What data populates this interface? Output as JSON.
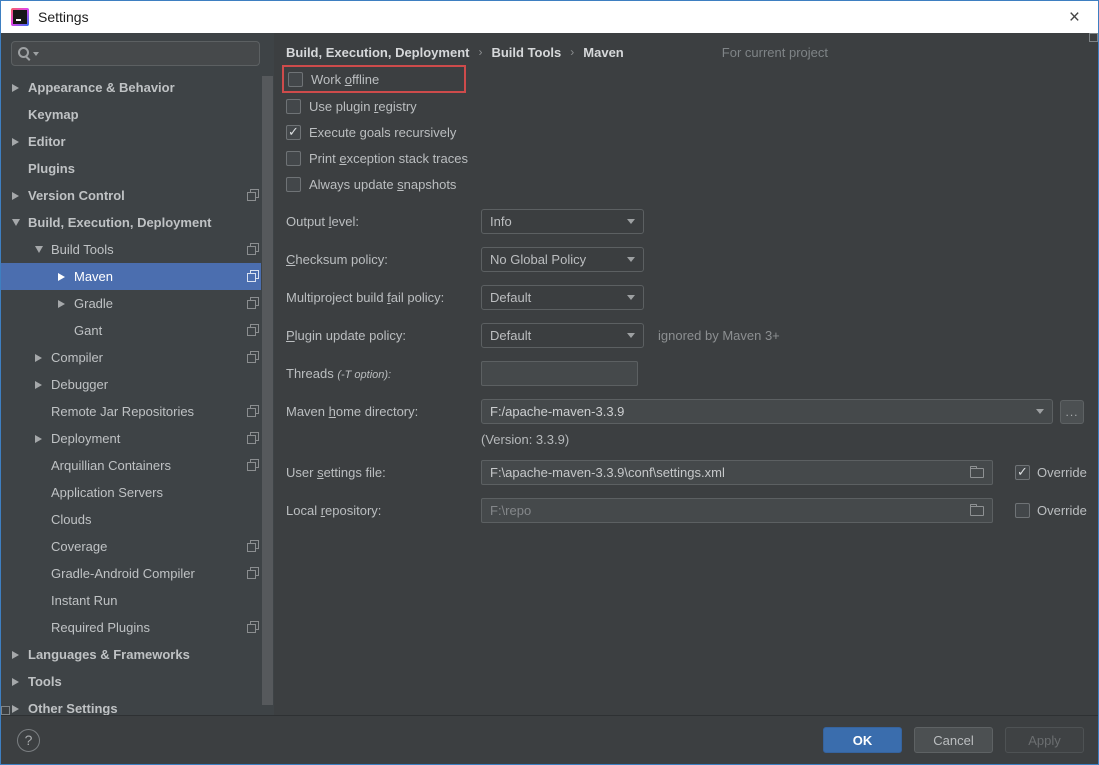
{
  "window": {
    "title": "Settings",
    "close_glyph": "×"
  },
  "colors": {
    "selection": "#4B6EAF",
    "highlight_red": "#CE4B4B",
    "ok_blue": "#3A6DAD",
    "window_border_blue": "#3E7FC1"
  },
  "icons": {
    "app_logo": "intellij-idea-logo",
    "search": "magnifier-with-caret",
    "scope_badge": "stacked-squares",
    "folder": "open-folder",
    "help": "question-mark",
    "close": "x"
  },
  "search": {
    "value": "",
    "placeholder": ""
  },
  "sidebar": {
    "items": [
      {
        "label": "Appearance & Behavior",
        "level": 0,
        "arrow": "collapsed",
        "bold": true,
        "selected": false,
        "badge": false
      },
      {
        "label": "Keymap",
        "level": 0,
        "arrow": "none",
        "bold": true,
        "selected": false,
        "badge": false
      },
      {
        "label": "Editor",
        "level": 0,
        "arrow": "collapsed",
        "bold": true,
        "selected": false,
        "badge": false
      },
      {
        "label": "Plugins",
        "level": 0,
        "arrow": "none",
        "bold": true,
        "selected": false,
        "badge": false
      },
      {
        "label": "Version Control",
        "level": 0,
        "arrow": "collapsed",
        "bold": true,
        "selected": false,
        "badge": true
      },
      {
        "label": "Build, Execution, Deployment",
        "level": 0,
        "arrow": "expanded",
        "bold": true,
        "selected": false,
        "badge": false
      },
      {
        "label": "Build Tools",
        "level": 1,
        "arrow": "expanded",
        "bold": false,
        "selected": false,
        "badge": true
      },
      {
        "label": "Maven",
        "level": 2,
        "arrow": "collapsed",
        "bold": false,
        "selected": true,
        "badge": true
      },
      {
        "label": "Gradle",
        "level": 2,
        "arrow": "collapsed",
        "bold": false,
        "selected": false,
        "badge": true
      },
      {
        "label": "Gant",
        "level": 2,
        "arrow": "none",
        "bold": false,
        "selected": false,
        "badge": true
      },
      {
        "label": "Compiler",
        "level": 1,
        "arrow": "collapsed",
        "bold": false,
        "selected": false,
        "badge": true
      },
      {
        "label": "Debugger",
        "level": 1,
        "arrow": "collapsed",
        "bold": false,
        "selected": false,
        "badge": false
      },
      {
        "label": "Remote Jar Repositories",
        "level": 1,
        "arrow": "none",
        "bold": false,
        "selected": false,
        "badge": true
      },
      {
        "label": "Deployment",
        "level": 1,
        "arrow": "collapsed",
        "bold": false,
        "selected": false,
        "badge": true
      },
      {
        "label": "Arquillian Containers",
        "level": 1,
        "arrow": "none",
        "bold": false,
        "selected": false,
        "badge": true
      },
      {
        "label": "Application Servers",
        "level": 1,
        "arrow": "none",
        "bold": false,
        "selected": false,
        "badge": false
      },
      {
        "label": "Clouds",
        "level": 1,
        "arrow": "none",
        "bold": false,
        "selected": false,
        "badge": false
      },
      {
        "label": "Coverage",
        "level": 1,
        "arrow": "none",
        "bold": false,
        "selected": false,
        "badge": true
      },
      {
        "label": "Gradle-Android Compiler",
        "level": 1,
        "arrow": "none",
        "bold": false,
        "selected": false,
        "badge": true
      },
      {
        "label": "Instant Run",
        "level": 1,
        "arrow": "none",
        "bold": false,
        "selected": false,
        "badge": false
      },
      {
        "label": "Required Plugins",
        "level": 1,
        "arrow": "none",
        "bold": false,
        "selected": false,
        "badge": true
      },
      {
        "label": "Languages & Frameworks",
        "level": 0,
        "arrow": "collapsed",
        "bold": true,
        "selected": false,
        "badge": false
      },
      {
        "label": "Tools",
        "level": 0,
        "arrow": "collapsed",
        "bold": true,
        "selected": false,
        "badge": false
      },
      {
        "label": "Other Settings",
        "level": 0,
        "arrow": "collapsed",
        "bold": true,
        "selected": false,
        "badge": false
      }
    ]
  },
  "breadcrumb": {
    "parts": [
      "Build, Execution, Deployment",
      "Build Tools",
      "Maven"
    ],
    "separator": "›",
    "scope_label": "For current project"
  },
  "main": {
    "checkboxes": [
      {
        "name": "work-offline",
        "segments": [
          {
            "t": "Work "
          },
          {
            "t": "o",
            "u": true
          },
          {
            "t": "ffline"
          }
        ],
        "checked": false,
        "highlighted": true
      },
      {
        "name": "use-plugin-registry",
        "segments": [
          {
            "t": "Use plugin "
          },
          {
            "t": "r",
            "u": true
          },
          {
            "t": "egistry"
          }
        ],
        "checked": false,
        "highlighted": false
      },
      {
        "name": "execute-goals-recursively",
        "segments": [
          {
            "t": "Execute "
          },
          {
            "t": "g",
            "u": true
          },
          {
            "t": "oals recursively"
          }
        ],
        "checked": true,
        "highlighted": false
      },
      {
        "name": "print-exception-stack-traces",
        "segments": [
          {
            "t": "Print "
          },
          {
            "t": "e",
            "u": true
          },
          {
            "t": "xception stack traces"
          }
        ],
        "checked": false,
        "highlighted": false
      },
      {
        "name": "always-update-snapshots",
        "segments": [
          {
            "t": "Always update "
          },
          {
            "t": "s",
            "u": true
          },
          {
            "t": "napshots"
          }
        ],
        "checked": false,
        "highlighted": false
      }
    ],
    "rows": [
      {
        "name": "output-level",
        "type": "combo",
        "segments": [
          {
            "t": "Output "
          },
          {
            "t": "l",
            "u": true
          },
          {
            "t": "evel:"
          }
        ],
        "value": "Info"
      },
      {
        "name": "checksum-policy",
        "type": "combo",
        "segments": [
          {
            "t": "C",
            "u": true
          },
          {
            "t": "hecksum policy:"
          }
        ],
        "value": "No Global Policy"
      },
      {
        "name": "multiproject-build-fail-policy",
        "type": "combo",
        "segments": [
          {
            "t": "Multiproject build "
          },
          {
            "t": "f",
            "u": true
          },
          {
            "t": "ail policy:"
          }
        ],
        "value": "Default"
      },
      {
        "name": "plugin-update-policy",
        "type": "combo",
        "segments": [
          {
            "t": "P",
            "u": true
          },
          {
            "t": "lugin update policy:"
          }
        ],
        "value": "Default",
        "note": "ignored by Maven 3+"
      },
      {
        "name": "threads",
        "type": "input",
        "segments": [
          {
            "t": "Threads "
          },
          {
            "t": "(-T option):",
            "i": true
          }
        ],
        "value": ""
      },
      {
        "name": "maven-home-directory",
        "type": "combo-browse",
        "segments": [
          {
            "t": "Maven "
          },
          {
            "t": "h",
            "u": true
          },
          {
            "t": "ome directory:"
          }
        ],
        "value": "F:/apache-maven-3.3.9",
        "browse_label": "...",
        "sub_text": "(Version: 3.3.9)"
      },
      {
        "name": "user-settings-file",
        "type": "path",
        "segments": [
          {
            "t": "User "
          },
          {
            "t": "s",
            "u": true
          },
          {
            "t": "ettings file:"
          }
        ],
        "value": "F:\\apache-maven-3.3.9\\conf\\settings.xml",
        "disabled": false,
        "override_label": "Override",
        "override_checked": true
      },
      {
        "name": "local-repository",
        "type": "path",
        "segments": [
          {
            "t": "Local "
          },
          {
            "t": "r",
            "u": true
          },
          {
            "t": "epository:"
          }
        ],
        "value": "F:\\repo",
        "disabled": true,
        "override_label": "Override",
        "override_checked": false
      }
    ]
  },
  "footer": {
    "help_label": "?",
    "ok": "OK",
    "cancel": "Cancel",
    "apply": "Apply"
  }
}
